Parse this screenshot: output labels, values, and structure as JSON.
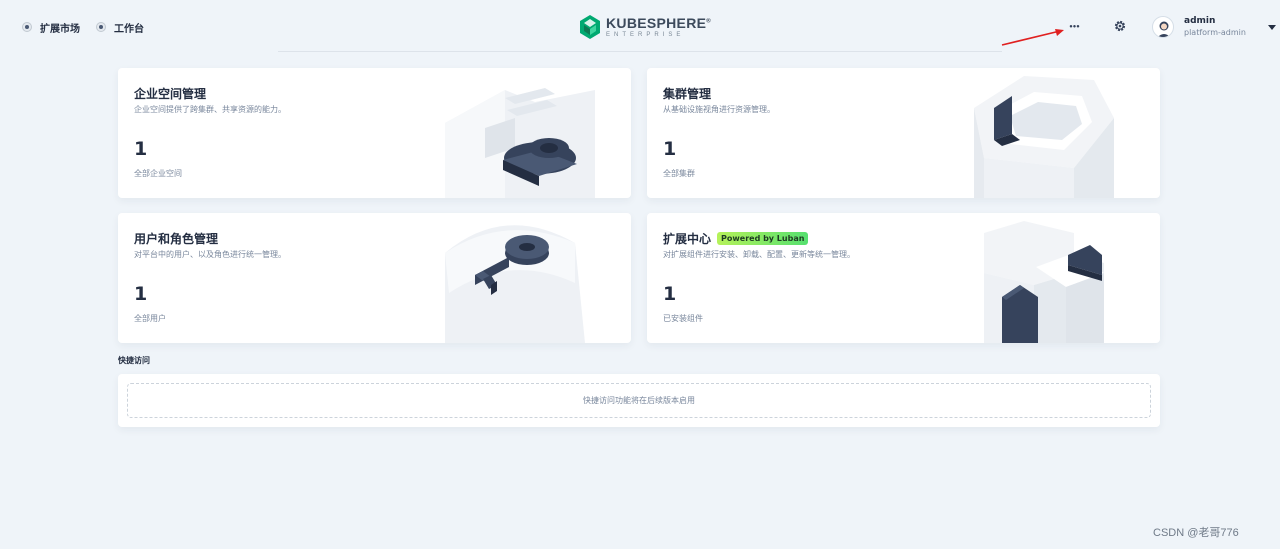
{
  "header": {
    "nav": [
      {
        "label": "扩展市场",
        "icon": "extension-market-icon"
      },
      {
        "label": "工作台",
        "icon": "workbench-icon"
      }
    ],
    "logo": {
      "main": "KUBESPHERE",
      "registered": "®",
      "sub": "ENTERPRISE"
    },
    "more_label": "•••",
    "user": {
      "name": "admin",
      "role": "platform-admin"
    }
  },
  "cards": [
    {
      "title": "企业空间管理",
      "desc": "企业空间提供了跨集群、共享资源的能力。",
      "count": "1",
      "count_label": "全部企业空间"
    },
    {
      "title": "集群管理",
      "desc": "从基础设施视角进行资源管理。",
      "count": "1",
      "count_label": "全部集群"
    },
    {
      "title": "用户和角色管理",
      "desc": "对平台中的用户、以及角色进行统一管理。",
      "count": "1",
      "count_label": "全部用户"
    },
    {
      "title": "扩展中心",
      "badge": "Powered by Luban",
      "desc": "对扩展组件进行安装、卸载、配置、更新等统一管理。",
      "count": "1",
      "count_label": "已安装组件"
    }
  ],
  "quick_access": {
    "title": "快捷访问",
    "placeholder": "快捷访问功能将在后续版本启用"
  },
  "watermark": "CSDN @老哥776",
  "colors": {
    "background": "#eff4f9",
    "text_primary": "#242e42",
    "text_secondary": "#79879c",
    "logo_green": "#00a971",
    "dark_slate": "#36435c",
    "annotation_red": "#e02020"
  }
}
